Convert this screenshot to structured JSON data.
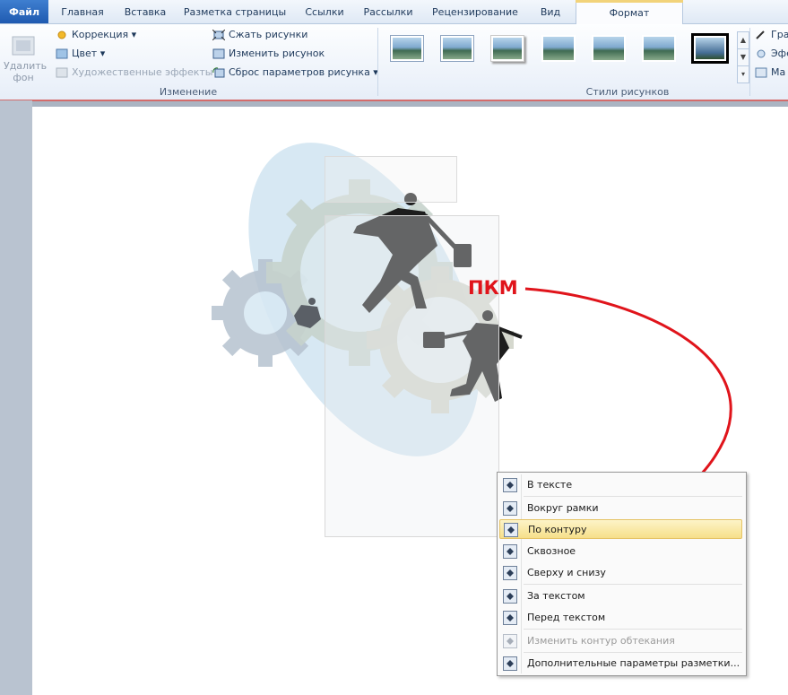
{
  "tabs": [
    {
      "label": "Файл"
    },
    {
      "label": "Главная"
    },
    {
      "label": "Вставка"
    },
    {
      "label": "Разметка страницы"
    },
    {
      "label": "Ссылки"
    },
    {
      "label": "Рассылки"
    },
    {
      "label": "Рецензирование"
    },
    {
      "label": "Вид"
    },
    {
      "label": "Формат"
    }
  ],
  "ribbon": {
    "remove_bg": {
      "line1": "Удалить",
      "line2": "фон"
    },
    "correction": "Коррекция",
    "color": "Цвет",
    "art_effects": "Художественные эффекты",
    "compress": "Сжать рисунки",
    "change": "Изменить рисунок",
    "reset": "Сброс параметров рисунка",
    "group_change_label": "Изменение",
    "group_styles_label": "Стили рисунков",
    "right_items": [
      "Гра",
      "Эфе",
      "Ма"
    ]
  },
  "annotation": {
    "label": "ПКМ"
  },
  "context_menu": {
    "items": [
      {
        "label": "В тексте",
        "icon": "wrap-inline-icon"
      },
      {
        "label": "Вокруг рамки",
        "icon": "wrap-square-icon"
      },
      {
        "label": "По контуру",
        "icon": "wrap-tight-icon",
        "highlighted": true
      },
      {
        "label": "Сквозное",
        "icon": "wrap-through-icon"
      },
      {
        "label": "Сверху и снизу",
        "icon": "wrap-topbottom-icon"
      },
      {
        "label": "За текстом",
        "icon": "behind-text-icon"
      },
      {
        "label": "Перед текстом",
        "icon": "in-front-text-icon"
      },
      {
        "label": "Изменить контур обтекания",
        "icon": "edit-wrap-points-icon",
        "disabled": true
      },
      {
        "label": "Дополнительные параметры разметки...",
        "icon": "more-layout-icon"
      }
    ]
  },
  "colors": {
    "accent": "#e0141b",
    "file_tab": "#2a66bd",
    "highlight": "#f6df8a"
  }
}
